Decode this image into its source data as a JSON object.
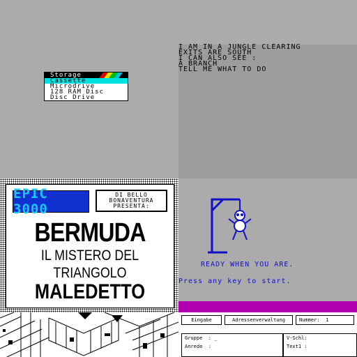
{
  "storage_menu": {
    "title": "Storage",
    "items": [
      "Cassette",
      "Microdrive",
      "128 RAM Disc",
      "Disc Drive"
    ],
    "selected_index": 0,
    "colors": {
      "menu_bg": "#ffffff",
      "selection": "#00e0e0",
      "stripe_red": "#e00000",
      "stripe_yellow": "#e0e000",
      "stripe_green": "#00c000",
      "stripe_cyan": "#00c0e0"
    }
  },
  "adventure": {
    "lines": [
      "I AM IN A JUNGLE CLEARING",
      "EXITS ARE SOUTH",
      "I CAN ALSO SEE :",
      "A BRANCH",
      "TELL ME WHAT TO DO"
    ]
  },
  "bermuda": {
    "badge": "EPIC 3000",
    "credit_lines": [
      "DI BELLO",
      "BONAVENTURA",
      "PRESENTA:"
    ],
    "title": "BERMUDA",
    "subtitle1": "IL MISTERO DEL",
    "subtitle2": "TRIANGOLO",
    "subtitle3": "MALEDETTO",
    "colors": {
      "badge_bg": "#1030d0",
      "badge_text": "#18c8ff"
    }
  },
  "hangman": {
    "ready_text": "READY WHEN YOU ARE.",
    "prompt_text": "Press any key to start.",
    "colors": {
      "gallows": "#1010c8",
      "bar": "#b000b0"
    }
  },
  "address_form": {
    "tab_input": "Eingabe",
    "tab_title": "Adressenverwaltung",
    "number_label": "Nummer:",
    "number_value": "1",
    "group_label": "Gruppe  : _",
    "salutation_label": "Anrede  :",
    "vschl_label": "V-Schl:",
    "text1_label": "Text1 :"
  }
}
